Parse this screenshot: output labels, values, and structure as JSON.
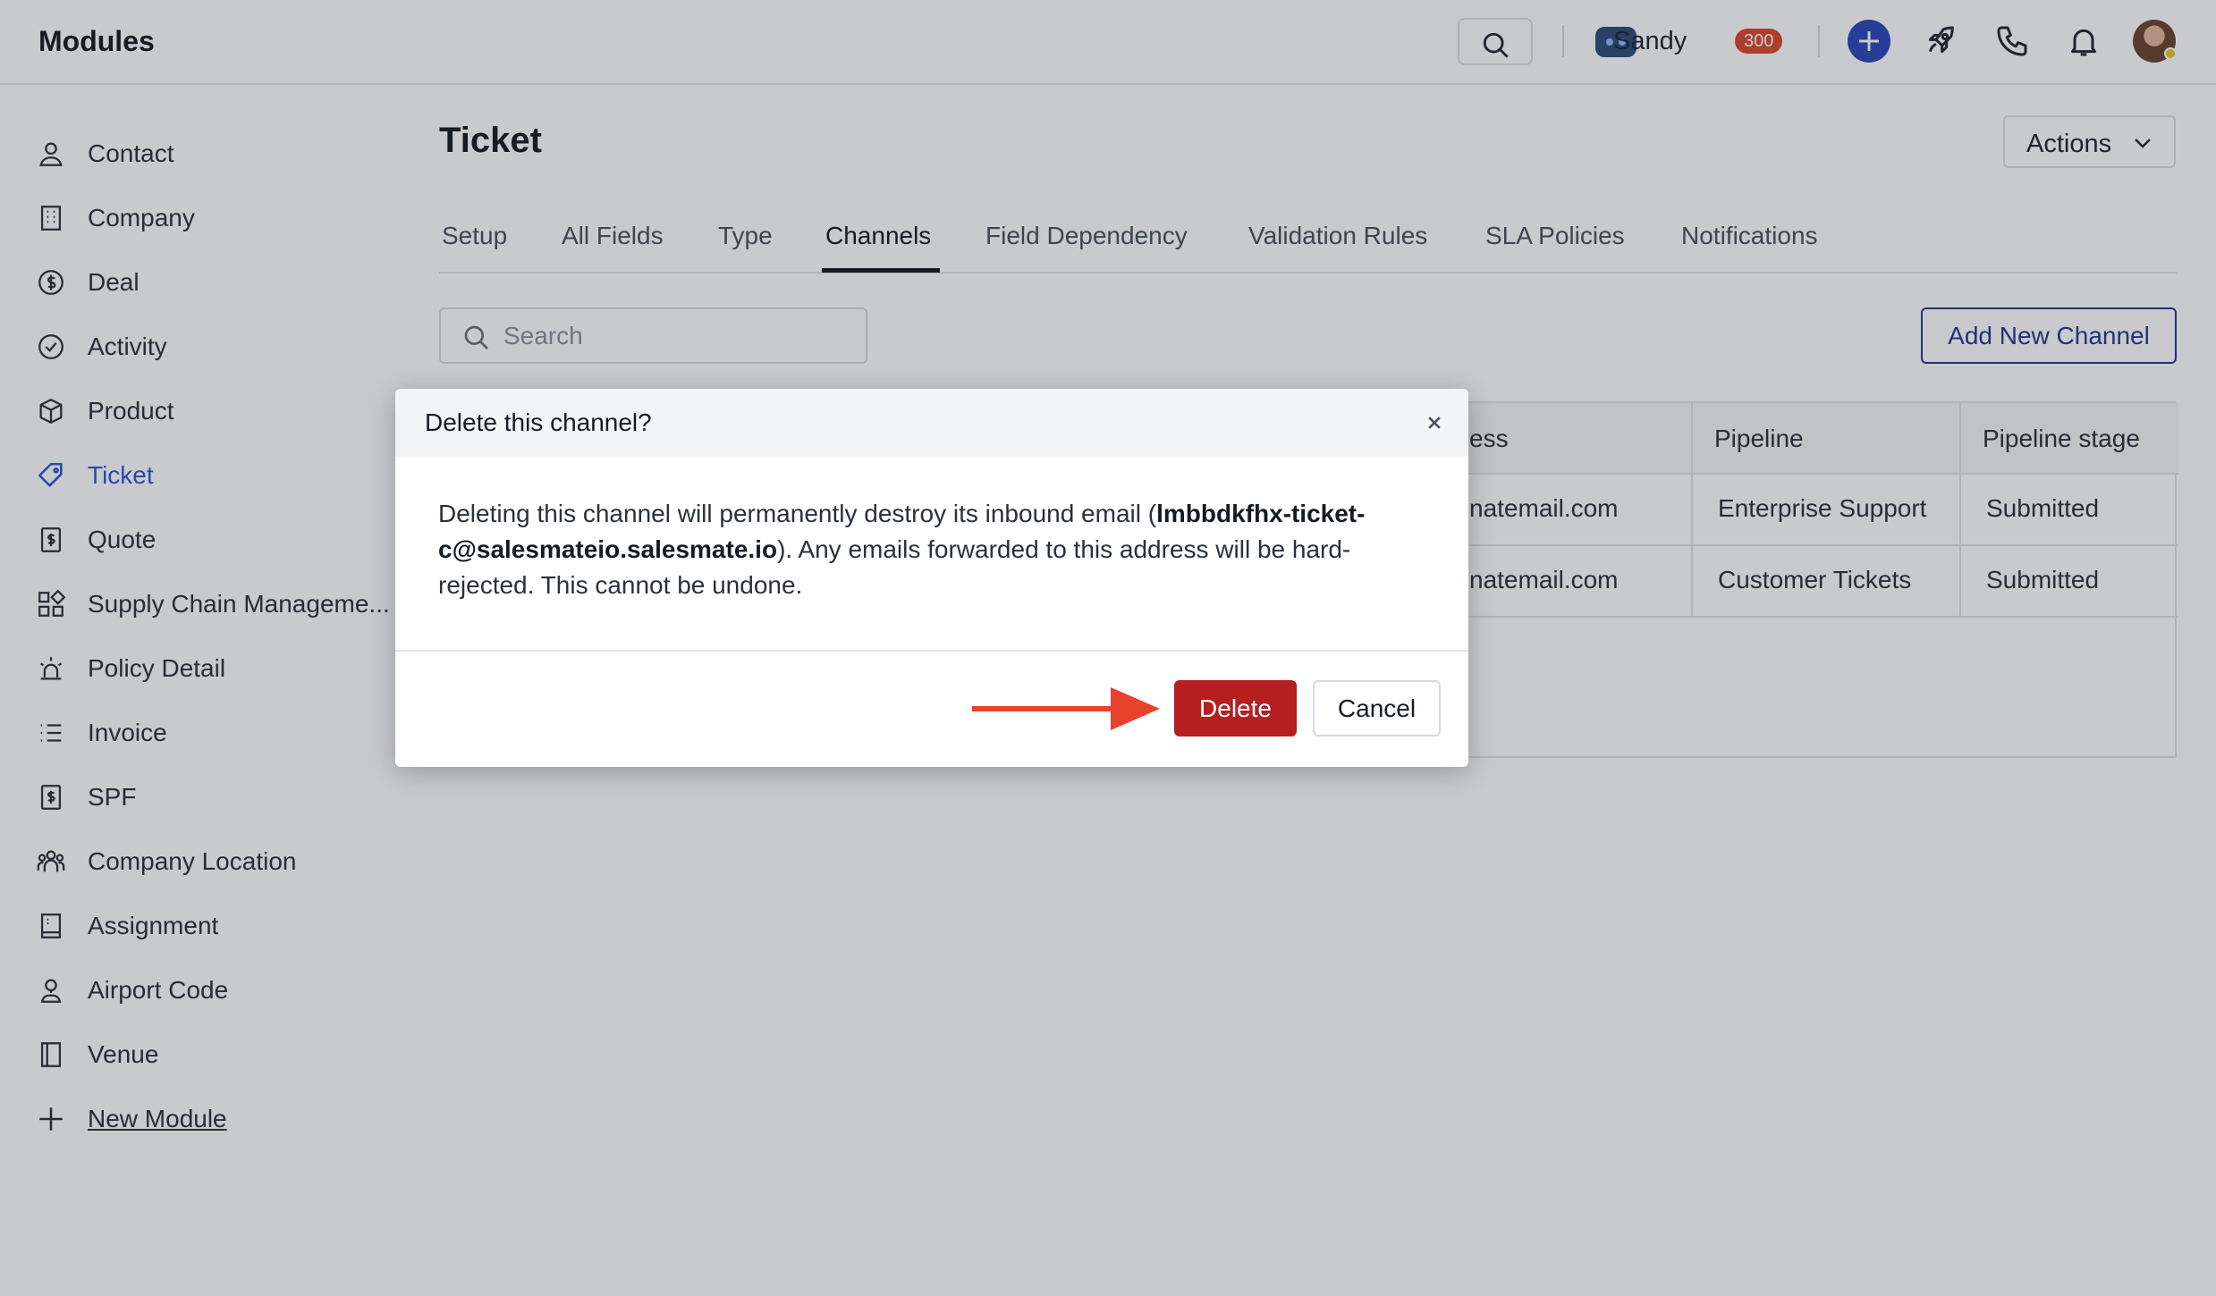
{
  "header": {
    "brand": "Modules",
    "user_name": "Sandy",
    "credits": "300"
  },
  "sidebar": {
    "items": [
      {
        "label": "Contact",
        "icon": "person-icon"
      },
      {
        "label": "Company",
        "icon": "building-icon"
      },
      {
        "label": "Deal",
        "icon": "dollar-circle-icon"
      },
      {
        "label": "Activity",
        "icon": "check-circle-icon"
      },
      {
        "label": "Product",
        "icon": "box-icon"
      },
      {
        "label": "Ticket",
        "icon": "ticket-icon",
        "active": true
      },
      {
        "label": "Quote",
        "icon": "dollar-doc-icon"
      },
      {
        "label": "Supply Chain Manageme...",
        "icon": "grid-icon"
      },
      {
        "label": "Policy Detail",
        "icon": "siren-icon"
      },
      {
        "label": "Invoice",
        "icon": "list-icon"
      },
      {
        "label": "SPF",
        "icon": "dollar-doc-icon"
      },
      {
        "label": "Company Location",
        "icon": "people-icon"
      },
      {
        "label": "Assignment",
        "icon": "notebook-icon"
      },
      {
        "label": "Airport Code",
        "icon": "map-pin-person-icon"
      },
      {
        "label": "Venue",
        "icon": "door-icon"
      },
      {
        "label": "New Module",
        "icon": "plus-icon"
      }
    ]
  },
  "main": {
    "title": "Ticket",
    "actions_label": "Actions",
    "tabs": [
      "Setup",
      "All Fields",
      "Type",
      "Channels",
      "Field Dependency",
      "Validation Rules",
      "SLA Policies",
      "Notifications"
    ],
    "active_tab": "Channels",
    "search_placeholder": "Search",
    "add_channel_label": "Add New Channel"
  },
  "table": {
    "columns": [
      "ess",
      "Pipeline",
      "Pipeline stage"
    ],
    "rows": [
      [
        "natemail.com",
        "Enterprise Support",
        "Submitted"
      ],
      [
        "natemail.com",
        "Customer Tickets",
        "Submitted"
      ]
    ]
  },
  "modal": {
    "title": "Delete this channel?",
    "body_before": "Deleting this channel will permanently destroy its inbound email (",
    "body_email": "lmbbdkfhx-ticket-c@salesmateio.salesmate.io",
    "body_after": "). Any emails forwarded to this address will be hard-rejected. This cannot be undone.",
    "delete_label": "Delete",
    "cancel_label": "Cancel"
  },
  "colors": {
    "accent_blue": "#2f55d4",
    "danger_red": "#b51f1f",
    "arrow_red": "#e8412c",
    "badge_red": "#d9472b"
  }
}
